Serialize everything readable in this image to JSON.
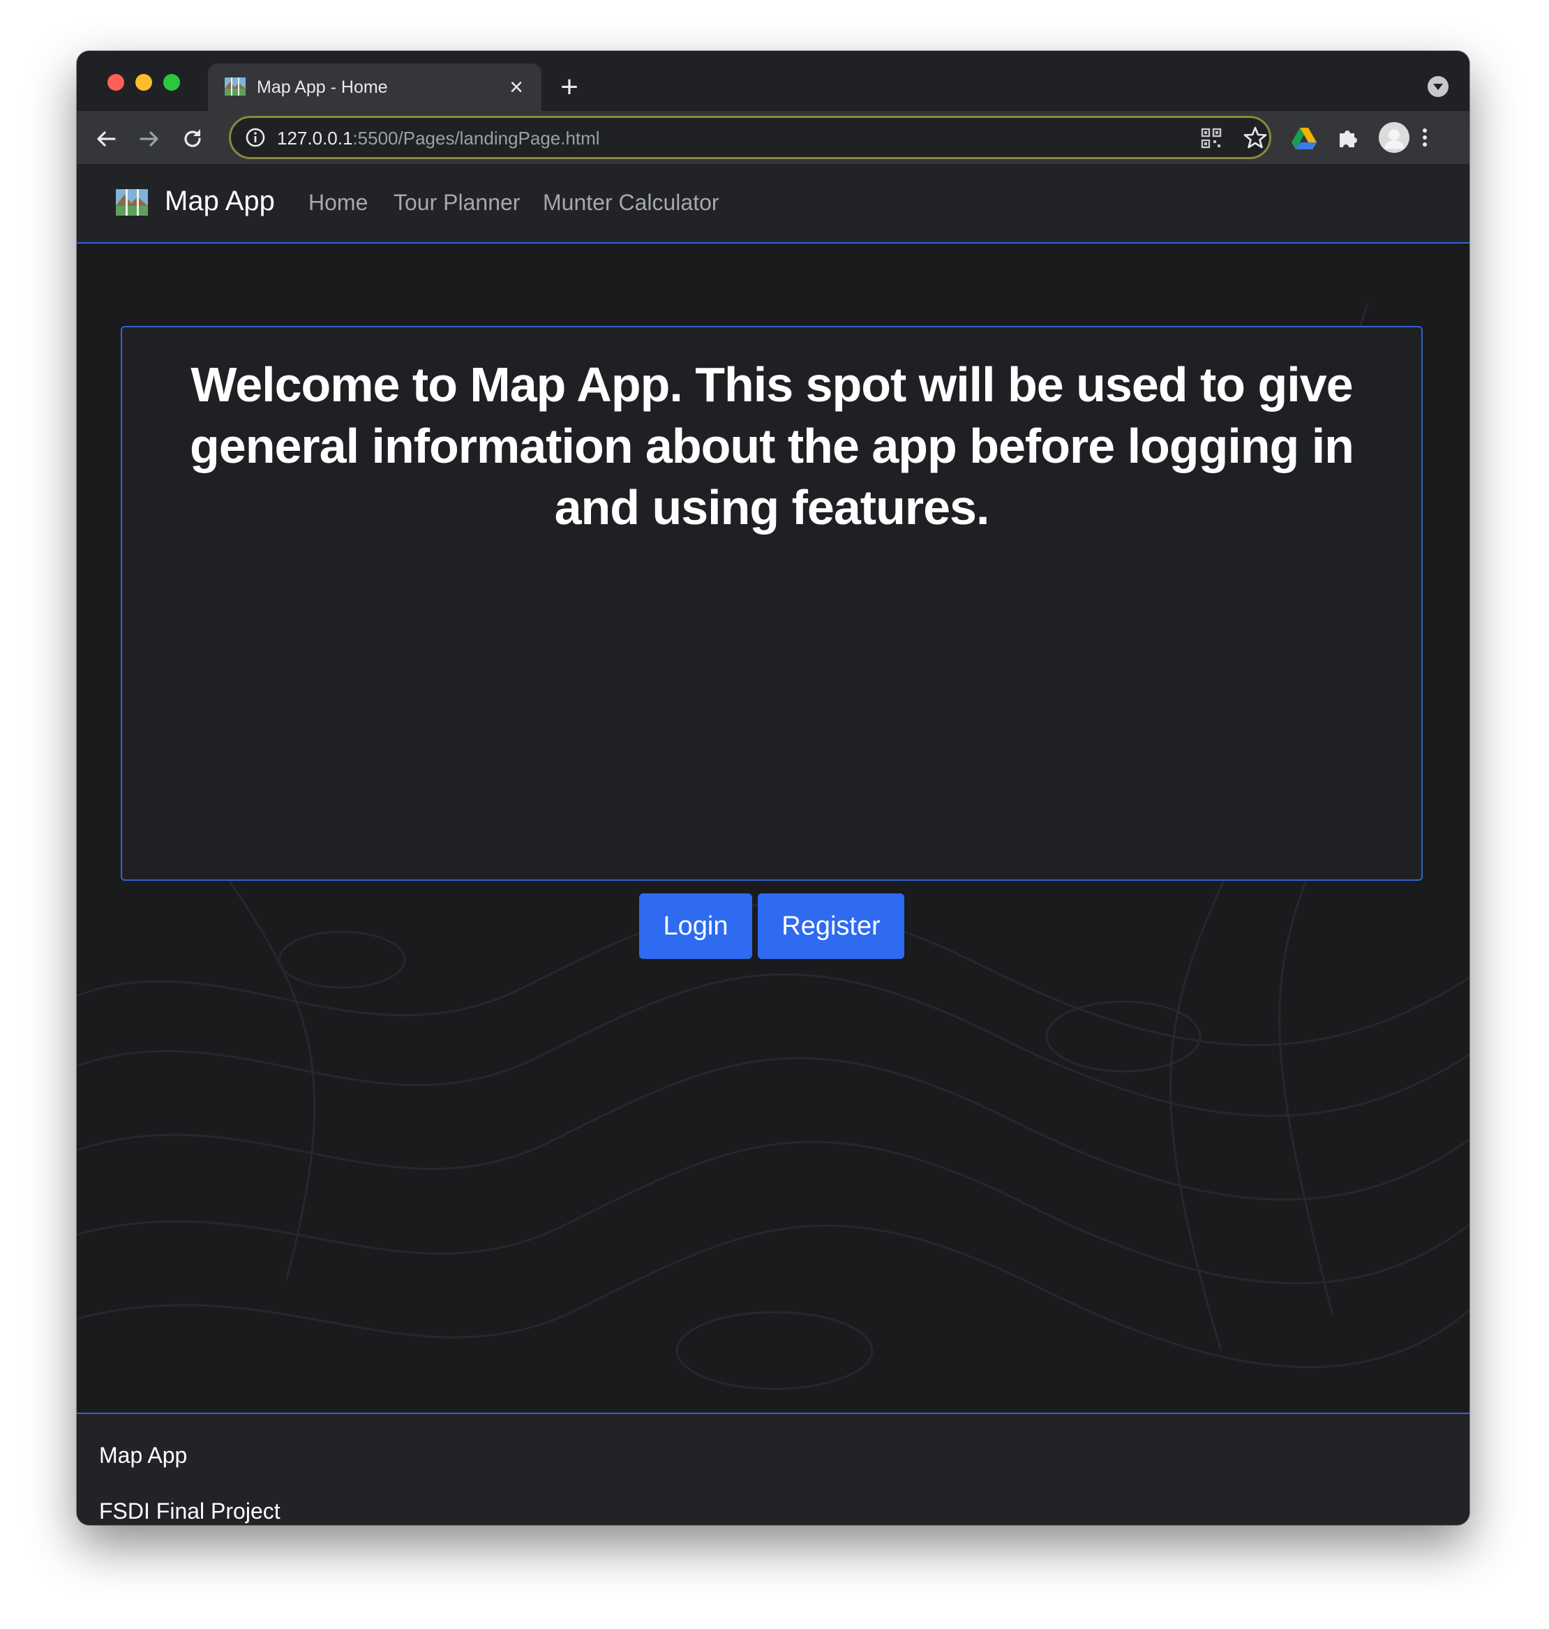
{
  "browser": {
    "tab_title": "Map App - Home",
    "url_host": "127.0.0.1",
    "url_rest": ":5500/Pages/landingPage.html",
    "omnibox_border_color": "#8a8a3a"
  },
  "navbar": {
    "brand": "Map App",
    "links": [
      {
        "label": "Home"
      },
      {
        "label": "Tour Planner"
      },
      {
        "label": "Munter Calculator"
      }
    ],
    "border_color": "#2f63d7"
  },
  "hero": {
    "text": "Welcome to Map App. This spot will be used to give general information about the app before logging in and using features."
  },
  "actions": {
    "login_label": "Login",
    "register_label": "Register",
    "button_color": "#2e6bf0"
  },
  "footer": {
    "line1": "Map App",
    "line2": "FSDI Final Project"
  },
  "icons": {
    "tab_favicon": "map-icon",
    "brand": "map-icon",
    "back": "back-arrow-icon",
    "forward": "forward-arrow-icon",
    "reload": "reload-icon",
    "site_info": "info-icon",
    "qr": "qr-code-icon",
    "bookmark": "star-icon",
    "drive": "google-drive-icon",
    "extensions": "puzzle-icon",
    "profile": "avatar-icon",
    "menu": "kebab-menu-icon"
  }
}
